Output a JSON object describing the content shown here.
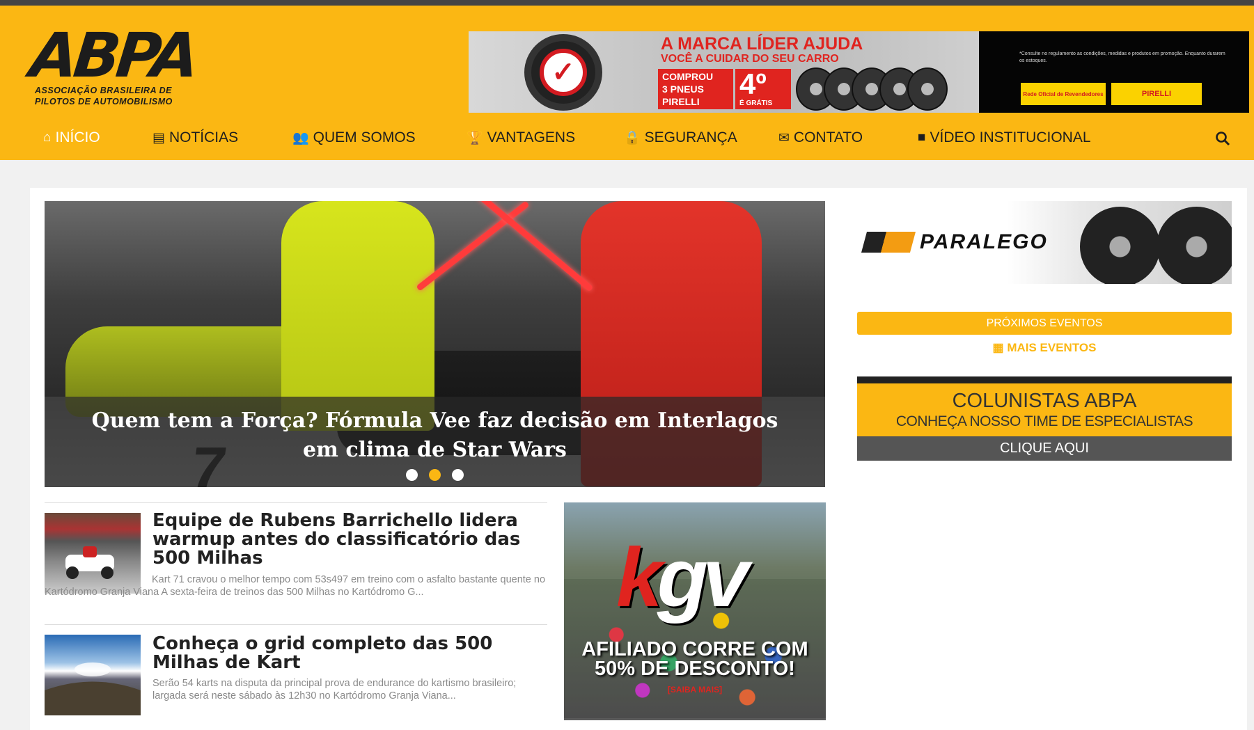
{
  "header": {
    "logo_text": "ABPA",
    "logo_tagline_1": "ASSOCIAÇÃO BRASILEIRA DE",
    "logo_tagline_2": "PILOTOS DE AUTOMOBILISMO",
    "banner": {
      "headline_1": "A MARCA LÍDER AJUDA",
      "headline_2": "VOCÊ A CUIDAR DO SEU CARRO",
      "offer_line_1": "COMPROU",
      "offer_line_2": "3 PNEUS",
      "offer_line_3": "PIRELLI",
      "offer_big": "4º",
      "offer_small": "É GRÁTIS",
      "fine_print": "*Consulte no regulamento as condições, medidas e produtos em promoção. Enquanto durarem os estoques.",
      "badge_1": "Rede Oficial de Revendedores",
      "badge_2": "PIRELLI"
    }
  },
  "nav": {
    "items": [
      {
        "label": "INÍCIO",
        "icon": "home-icon"
      },
      {
        "label": "NOTÍCIAS",
        "icon": "newspaper-icon"
      },
      {
        "label": "QUEM SOMOS",
        "icon": "users-icon"
      },
      {
        "label": "VANTAGENS",
        "icon": "trophy-icon"
      },
      {
        "label": "SEGURANÇA",
        "icon": "lock-icon"
      },
      {
        "label": "CONTATO",
        "icon": "envelope-icon"
      },
      {
        "label": "VÍDEO INSTITUCIONAL",
        "icon": "video-icon"
      }
    ],
    "search_icon": "search-icon"
  },
  "slider": {
    "caption": "Quem tem a Força? Fórmula Vee faz decisão em Interlagos em clima de Star Wars",
    "car_number": "7",
    "dots": 3,
    "active_dot": 2
  },
  "news": [
    {
      "title": "Equipe de Rubens Barrichello lidera warmup antes do classificatório das 500 Milhas",
      "excerpt": "Kart 71 cravou o melhor tempo com 53s497 em treino com o asfalto bastante quente no Kartódromo Granja Viana A sexta-feira de treinos das 500 Milhas no Kartódromo G..."
    },
    {
      "title": "Conheça o grid completo das 500 Milhas de Kart",
      "excerpt": "Serão 54 karts na disputa da principal prova de endurance do kartismo brasileiro; largada será neste sábado às 12h30 no Kartódromo Granja Viana..."
    }
  ],
  "kgv_ad": {
    "logo_k": "k",
    "logo_rest": "gv",
    "line_1": "AFILIADO CORRE COM",
    "line_2": "50% DE DESCONTO!",
    "more": "[SAIBA MAIS]"
  },
  "sidebar": {
    "sponsor_name": "PARALEGO",
    "events_title": "PRÓXIMOS EVENTOS",
    "more_events": "MAIS EVENTOS",
    "colunistas_title": "COLUNISTAS ABPA",
    "colunistas_sub": "CONHEÇA NOSSO TIME DE ESPECIALISTAS",
    "colunistas_button": "CLIQUE AQUI"
  },
  "colors": {
    "brand_yellow": "#fbb713",
    "accent_red": "#e0241f",
    "dark": "#1e1e1e"
  }
}
